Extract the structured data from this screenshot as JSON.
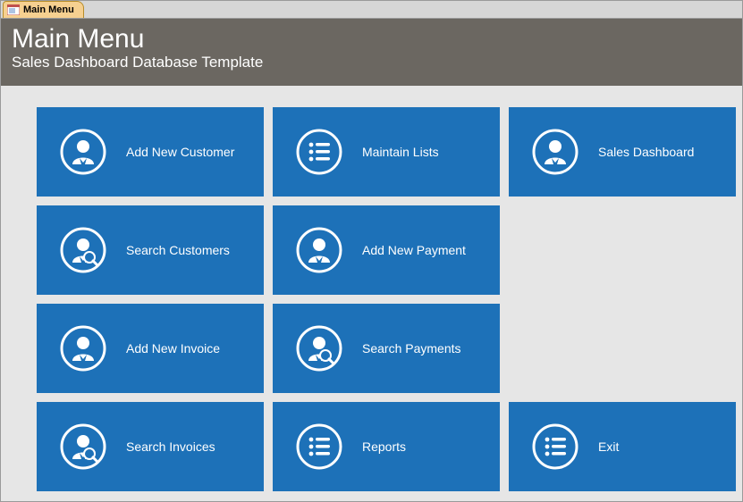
{
  "tab": {
    "label": "Main Menu"
  },
  "header": {
    "title": "Main Menu",
    "subtitle": "Sales Dashboard Database Template"
  },
  "colors": {
    "tile": "#1d71b8",
    "header": "#6b6761",
    "tab": "#f6d090"
  },
  "tiles": [
    {
      "label": "Add New Customer",
      "icon": "person"
    },
    {
      "label": "Maintain Lists",
      "icon": "list"
    },
    {
      "label": "Sales Dashboard",
      "icon": "person"
    },
    {
      "label": "Search Customers",
      "icon": "person-search"
    },
    {
      "label": "Add New Payment",
      "icon": "person"
    },
    {
      "label": "Add New Invoice",
      "icon": "person"
    },
    {
      "label": "Search Payments",
      "icon": "person-search"
    },
    {
      "label": "Search Invoices",
      "icon": "person-search"
    },
    {
      "label": "Reports",
      "icon": "list"
    },
    {
      "label": "Exit",
      "icon": "list"
    }
  ]
}
